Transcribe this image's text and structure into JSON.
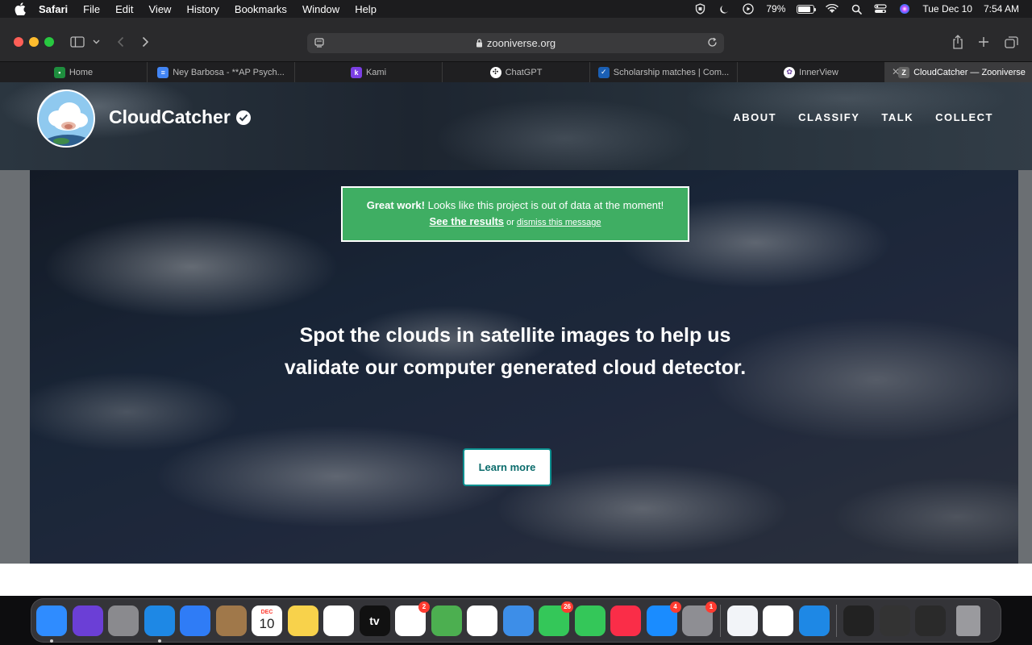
{
  "menubar": {
    "app": "Safari",
    "items": [
      "File",
      "Edit",
      "View",
      "History",
      "Bookmarks",
      "Window",
      "Help"
    ],
    "battery": "79%",
    "battery_level": 0.79,
    "date": "Tue Dec 10",
    "time": "7:54 AM"
  },
  "address": {
    "url": "zooniverse.org"
  },
  "tabs": [
    {
      "label": "Home",
      "icon": "classroom-icon",
      "color": "#1e8e3e"
    },
    {
      "label": "Ney Barbosa - **AP Psych...",
      "icon": "docs-icon",
      "color": "#4285f4"
    },
    {
      "label": "Kami",
      "icon": "kami-icon",
      "color": "#7b3fe4"
    },
    {
      "label": "ChatGPT",
      "icon": "chatgpt-icon",
      "color": "#444444"
    },
    {
      "label": "Scholarship matches | Com...",
      "icon": "scholarship-icon",
      "color": "#1a5fb4"
    },
    {
      "label": "InnerView",
      "icon": "innerview-icon",
      "color": "#6a3fa0"
    },
    {
      "label": "CloudCatcher — Zooniverse",
      "icon": "zooniverse-icon",
      "color": "#666666",
      "active": true
    }
  ],
  "project": {
    "name": "CloudCatcher",
    "nav": [
      "ABOUT",
      "CLASSIFY",
      "TALK",
      "COLLECT"
    ]
  },
  "notice": {
    "strong": "Great work!",
    "message": " Looks like this project is out of data at the moment!",
    "results_link": "See the results",
    "or": " or ",
    "dismiss_link": "dismiss this message",
    "color": "#3fae63"
  },
  "hero": {
    "tagline": "Spot the clouds in satellite images to help us validate our computer generated cloud detector.",
    "button": "Learn more"
  },
  "dock": [
    {
      "name": "finder",
      "color": "#2f8cff",
      "dot": true
    },
    {
      "name": "siri",
      "color": "#6b3fd6"
    },
    {
      "name": "launchpad",
      "color": "#8a8a8e"
    },
    {
      "name": "safari",
      "color": "#1e88e5",
      "dot": true
    },
    {
      "name": "mail",
      "color": "#2f7cf6"
    },
    {
      "name": "contacts",
      "color": "#a0784a"
    },
    {
      "name": "calendar",
      "color": "#ffffff",
      "text": "10",
      "sub": "DEC"
    },
    {
      "name": "notes",
      "color": "#f8d24b"
    },
    {
      "name": "freeform",
      "color": "#ffffff"
    },
    {
      "name": "tv",
      "color": "#111111",
      "text": "tv"
    },
    {
      "name": "reminders",
      "color": "#ffffff",
      "badge": "2"
    },
    {
      "name": "maps",
      "color": "#4caf50"
    },
    {
      "name": "photos",
      "color": "#ffffff"
    },
    {
      "name": "weather",
      "color": "#3d8ee8"
    },
    {
      "name": "messages",
      "color": "#34c759",
      "badge": "26"
    },
    {
      "name": "facetime",
      "color": "#34c759"
    },
    {
      "name": "music",
      "color": "#fa2d48"
    },
    {
      "name": "app-store",
      "color": "#1a8cff",
      "badge": "4"
    },
    {
      "name": "system-settings",
      "color": "#8e8e93",
      "badge": "1"
    },
    {
      "name": "sep"
    },
    {
      "name": "cortex",
      "color": "#f2f4f8"
    },
    {
      "name": "chrome",
      "color": "#ffffff"
    },
    {
      "name": "dolphin",
      "color": "#1e88e5"
    },
    {
      "name": "sep"
    },
    {
      "name": "screenshot-1",
      "color": "#222222"
    },
    {
      "name": "screenshot-2",
      "color": "#333333"
    },
    {
      "name": "screenshot-3",
      "color": "#2a2a2a"
    },
    {
      "name": "trash",
      "color": "#9a9a9e"
    }
  ]
}
